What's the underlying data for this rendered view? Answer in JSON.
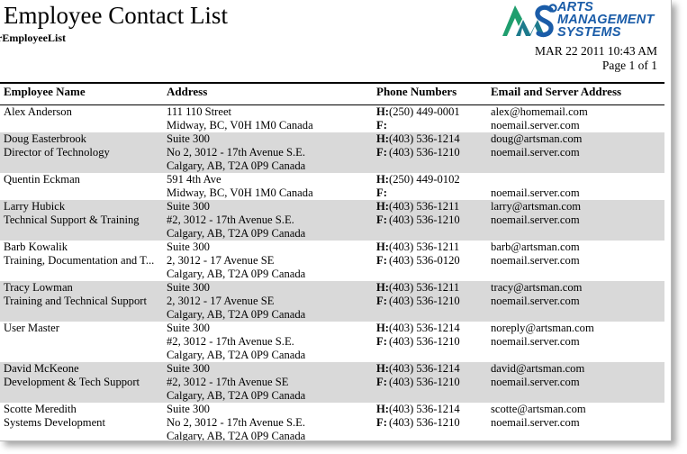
{
  "document": {
    "title": "Employee Contact List",
    "subtitle": "rEmployeeList",
    "timestamp": "MAR 22 2011 10:43 AM",
    "page_number": "Page 1 of 1"
  },
  "logo": {
    "name": "arts-management-systems-logo",
    "line1": "ARTS",
    "line2": "MANAGEMENT",
    "line3": "SYSTEMS",
    "colors": {
      "green": "#1f9e6e",
      "teal": "#1d7a8c",
      "blue": "#1a5ca8"
    }
  },
  "table": {
    "columns": [
      "Employee Name",
      "Address",
      "Phone Numbers",
      "Email and Server Address"
    ],
    "rows": [
      {
        "shaded": false,
        "name_line1": "Alex Anderson",
        "name_line2": "",
        "address_line1": "111 110 Street",
        "address_line2": "Midway, BC, V0H 1M0 Canada",
        "address_line3": "",
        "phone_home_label": "H:",
        "phone_home": "(250) 449-0001",
        "phone_fax_label": "F:",
        "phone_fax": "",
        "email": "alex@homemail.com",
        "server": "noemail.server.com"
      },
      {
        "shaded": true,
        "name_line1": "Doug Easterbrook",
        "name_line2": "Director of Technology",
        "address_line1": "Suite 300",
        "address_line2": "No 2, 3012 - 17th Avenue S.E.",
        "address_line3": "Calgary, AB, T2A 0P9 Canada",
        "phone_home_label": "H:",
        "phone_home": "(403) 536-1214",
        "phone_fax_label": "F:",
        "phone_fax": "(403) 536-1210",
        "email": "doug@artsman.com",
        "server": "noemail.server.com"
      },
      {
        "shaded": false,
        "name_line1": "Quentin Eckman",
        "name_line2": "",
        "address_line1": "591 4th Ave",
        "address_line2": "Midway, BC, V0H 1M0 Canada",
        "address_line3": "",
        "phone_home_label": "H:",
        "phone_home": "(250) 449-0102",
        "phone_fax_label": "F:",
        "phone_fax": "",
        "email": "",
        "server": "noemail.server.com"
      },
      {
        "shaded": true,
        "name_line1": "Larry Hubick",
        "name_line2": "Technical Support & Training",
        "address_line1": "Suite 300",
        "address_line2": "#2, 3012 - 17th Avenue S.E.",
        "address_line3": "Calgary, AB, T2A 0P9 Canada",
        "phone_home_label": "H:",
        "phone_home": "(403) 536-1211",
        "phone_fax_label": "F:",
        "phone_fax": "(403) 536-1210",
        "email": "larry@artsman.com",
        "server": "noemail.server.com"
      },
      {
        "shaded": false,
        "name_line1": "Barb Kowalik",
        "name_line2": "Training, Documentation and T...",
        "address_line1": "Suite 300",
        "address_line2": "2, 3012 - 17 Avenue SE",
        "address_line3": "Calgary, AB, T2A 0P9 Canada",
        "phone_home_label": "H:",
        "phone_home": "(403) 536-1211",
        "phone_fax_label": "F:",
        "phone_fax": "(403) 536-0120",
        "email": "barb@artsman.com",
        "server": "noemail.server.com"
      },
      {
        "shaded": true,
        "name_line1": "Tracy Lowman",
        "name_line2": "Training and Technical Support",
        "address_line1": "Suite 300",
        "address_line2": "2, 3012 - 17 Avenue SE",
        "address_line3": "Calgary, AB, T2A 0P9 Canada",
        "phone_home_label": "H:",
        "phone_home": "(403) 536-1211",
        "phone_fax_label": "F:",
        "phone_fax": "(403) 536-1210",
        "email": "tracy@artsman.com",
        "server": "noemail.server.com"
      },
      {
        "shaded": false,
        "name_line1": "User Master",
        "name_line2": "",
        "address_line1": "Suite 300",
        "address_line2": "#2, 3012 - 17th Avenue S.E.",
        "address_line3": "Calgary, AB, T2A 0P9 Canada",
        "phone_home_label": "H:",
        "phone_home": "(403) 536-1214",
        "phone_fax_label": "F:",
        "phone_fax": "(403) 536-1210",
        "email": "noreply@artsman.com",
        "server": "noemail.server.com"
      },
      {
        "shaded": true,
        "name_line1": "David McKeone",
        "name_line2": "Development & Tech Support",
        "address_line1": "Suite 300",
        "address_line2": "#2, 3012 - 17th Avenue SE",
        "address_line3": "Calgary, AB, T2A 0P9 Canada",
        "phone_home_label": "H:",
        "phone_home": "(403) 536-1214",
        "phone_fax_label": "F:",
        "phone_fax": "(403) 536-1210",
        "email": "david@artsman.com",
        "server": "noemail.server.com"
      },
      {
        "shaded": false,
        "name_line1": "Scotte Meredith",
        "name_line2": "Systems Development",
        "address_line1": "Suite 300",
        "address_line2": "No 2, 3012 - 17th Avenue S.E.",
        "address_line3": "Calgary, AB, T2A 0P9 Canada",
        "phone_home_label": "H:",
        "phone_home": "(403) 536-1214",
        "phone_fax_label": "F:",
        "phone_fax": "(403) 536-1210",
        "email": "scotte@artsman.com",
        "server": "noemail.server.com"
      }
    ]
  }
}
